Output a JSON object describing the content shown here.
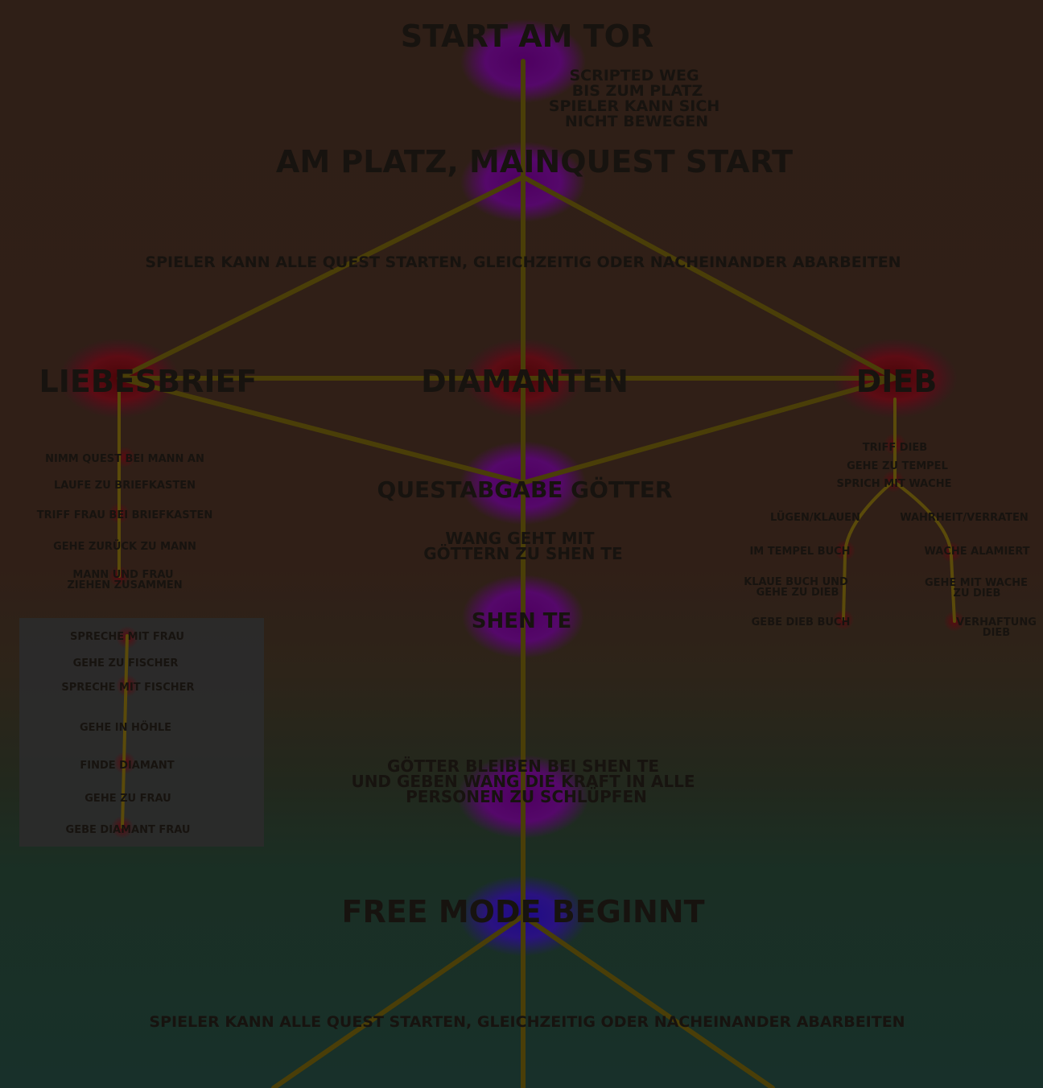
{
  "colors": {
    "connector": "#4a3e08",
    "story_node": "#5a0a5e",
    "quest_node": "#5e0f14",
    "free_node": "#2a1280",
    "text": "#17130f"
  },
  "main": {
    "start": "START AM TOR",
    "scripted_note": [
      "SCRIPTED WEG",
      "BIS ZUM PLATZ",
      "SPIELER KANN SICH",
      "NICHT BEWEGEN"
    ],
    "mainquest": "AM PLATZ, MAINQUEST START",
    "parallel_note": "SPIELER KANN ALLE QUEST STARTEN, GLEICHZEITIG ODER NACHEINANDER ABARBEITEN",
    "delivery": "QUESTABGABE GÖTTER",
    "wang_note": [
      "WANG GEHT MIT",
      "GÖTTERN ZU SHEN TE"
    ],
    "shen_te": "SHEN TE",
    "gods_note": [
      "GÖTTER BLEIBEN BEI SHEN TE",
      "UND GEBEN WANG DIE KRAFT IN ALLE",
      "PERSONEN ZU SCHLÜPFEN"
    ],
    "free_mode": "FREE MODE BEGINNT",
    "parallel_note_2": "SPIELER KANN ALLE QUEST STARTEN, GLEICHZEITIG ODER NACHEINANDER ABARBEITEN"
  },
  "quests": {
    "liebesbrief": {
      "title": "LIEBESBRIEF",
      "steps": [
        "NIMM QUEST BEI MANN AN",
        "LAUFE ZU BRIEFKASTEN",
        "TRIFF FRAU BEI BRIEFKASTEN",
        "GEHE ZURÜCK ZU MANN"
      ],
      "final": [
        "MANN UND FRAU",
        "ZIEHEN ZUSAMMEN"
      ]
    },
    "diamanten": {
      "title": "DIAMANTEN",
      "steps": [
        "SPRECHE MIT FRAU",
        "GEHE ZU FISCHER",
        "SPRECHE MIT FISCHER",
        "GEHE IN HÖHLE",
        "FINDE DIAMANT",
        "GEHE ZU FRAU",
        "GEBE DIAMANT FRAU"
      ]
    },
    "dieb": {
      "title": "DIEB",
      "steps": [
        "TRIFF DIEB",
        "GEHE ZU TEMPEL",
        "SPRICH MIT WACHE"
      ],
      "branch_left": {
        "label": "LÜGEN/KLAUEN",
        "steps": [
          "IM TEMPEL BUCH"
        ],
        "step2": [
          "KLAUE BUCH UND",
          "GEHE ZU DIEB"
        ],
        "step3": "GEBE DIEB BUCH"
      },
      "branch_right": {
        "label": "WAHRHEIT/VERRATEN",
        "steps": [
          "WACHE ALAMIERT"
        ],
        "step2": [
          "GEHE MIT WACHE",
          "ZU DIEB"
        ],
        "step3": [
          "VERHAFTUNG",
          "DIEB"
        ]
      }
    }
  }
}
